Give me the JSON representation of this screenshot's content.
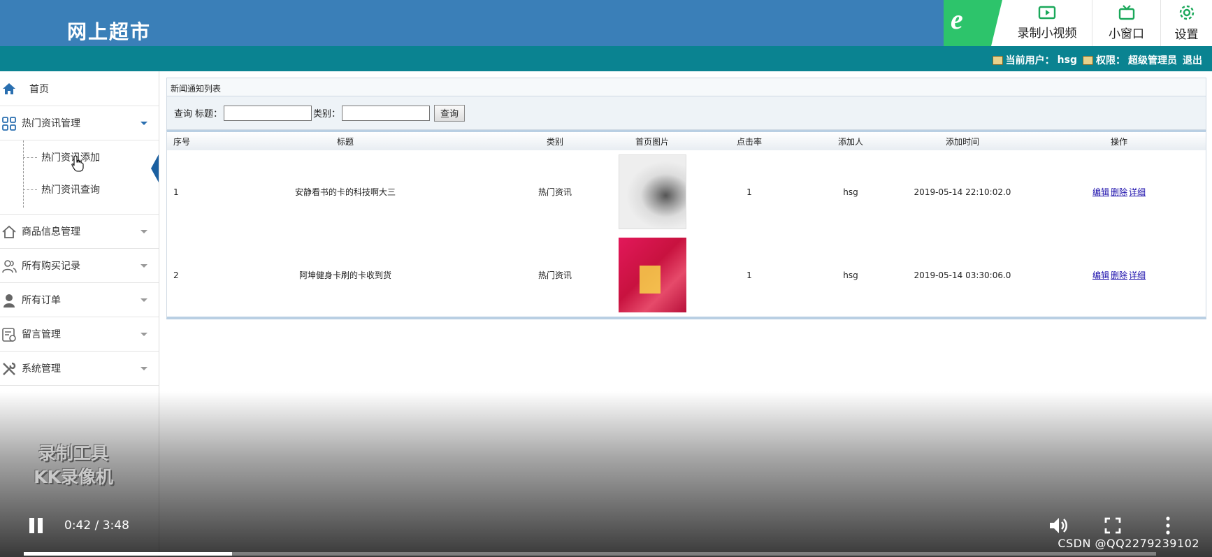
{
  "header": {
    "brand": "网上超市",
    "ext_toolbar": {
      "logo_glyph": "e",
      "record_label": "录制小视频",
      "mini_window_label": "小窗口",
      "settings_label": "设置",
      "accent_color": "#2dc46b"
    }
  },
  "userbar": {
    "current_user_label": "当前用户：",
    "current_user": "hsg",
    "role_label": "权限：",
    "role": "超级管理员",
    "logout_label": "退出"
  },
  "sidebar": {
    "home_label": "首页",
    "groups": [
      {
        "label": "热门资讯管理",
        "icon": "grid-icon",
        "expanded": true,
        "children": [
          {
            "label": "热门资讯添加",
            "active": true
          },
          {
            "label": "热门资讯查询",
            "active": false
          }
        ]
      },
      {
        "label": "商品信息管理",
        "icon": "home-outline-icon"
      },
      {
        "label": "所有购买记录",
        "icon": "users-icon"
      },
      {
        "label": "所有订单",
        "icon": "person-icon"
      },
      {
        "label": "留言管理",
        "icon": "message-board-icon"
      },
      {
        "label": "系统管理",
        "icon": "tools-icon"
      }
    ]
  },
  "main": {
    "panel_title": "新闻通知列表",
    "search": {
      "prefix_label": "查询",
      "title_label": "标题：",
      "title_value": "",
      "category_label": "类别：",
      "category_value": "",
      "button_label": "查询"
    },
    "table": {
      "columns": [
        "序号",
        "标题",
        "类别",
        "首页图片",
        "点击率",
        "添加人",
        "添加时间",
        "操作"
      ],
      "rows": [
        {
          "num": "1",
          "title": "安静看书的卡的科技啊大三",
          "category": "热门资讯",
          "image": "thumb-ink-painting",
          "clicks": "1",
          "author": "hsg",
          "time": "2019-05-14 22:10:02.0"
        },
        {
          "num": "2",
          "title": "阿坤健身卡刷的卡收到货",
          "category": "热门资讯",
          "image": "thumb-red-poster",
          "clicks": "1",
          "author": "hsg",
          "time": "2019-05-14 03:30:06.0"
        }
      ],
      "actions": {
        "edit": "编辑",
        "delete": "删除",
        "detail": "详细"
      }
    }
  },
  "player": {
    "watermark_line1": "录制工具",
    "watermark_line2": "KK录像机",
    "current_time": "0:42",
    "duration": "3:48",
    "progress_fraction": 0.184,
    "source_mark": "CSDN @QQ2279239102"
  }
}
